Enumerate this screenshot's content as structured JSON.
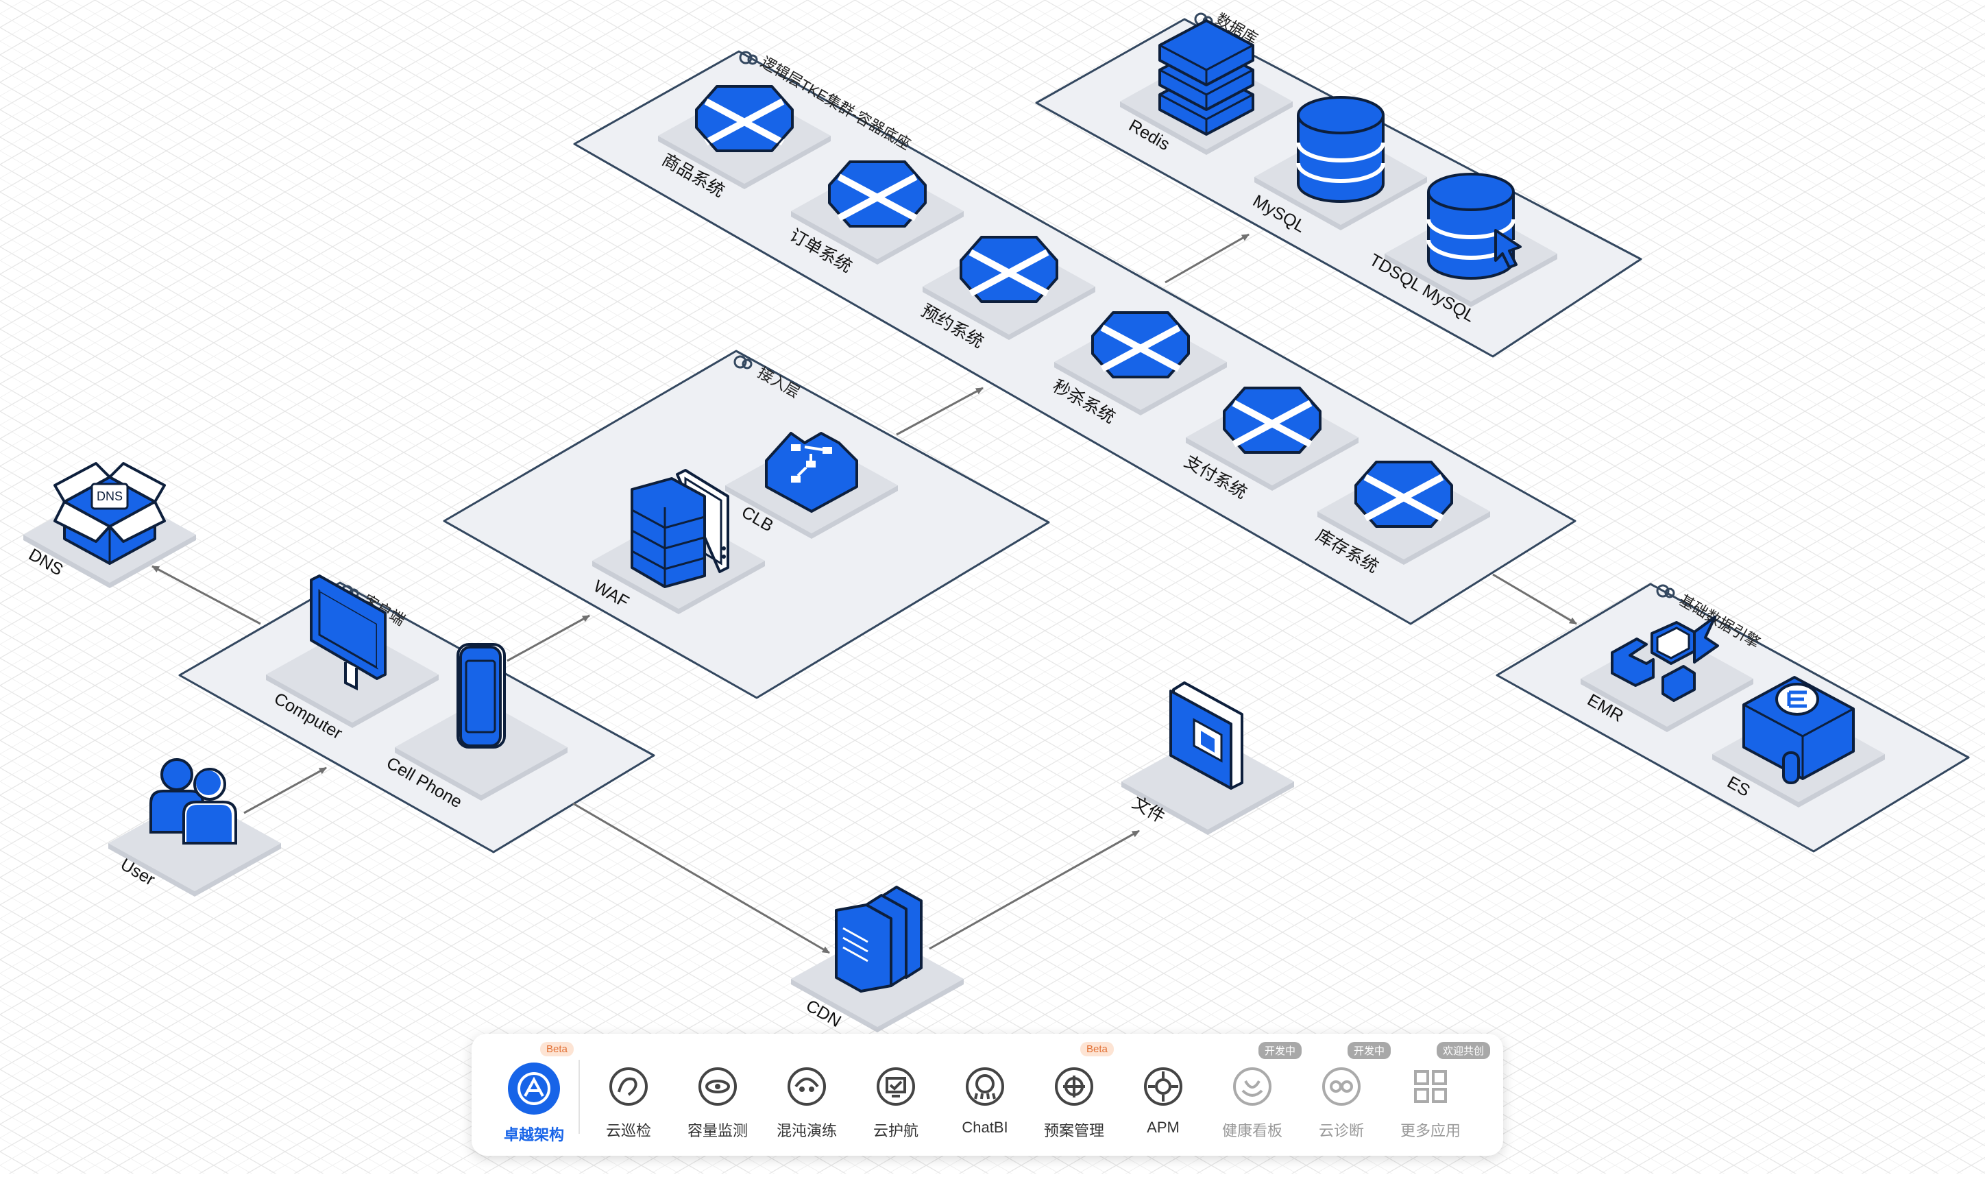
{
  "groups": {
    "logic": "逻辑层TKE集群-容器底座",
    "data": "数据库",
    "access": "接入层",
    "client": "客户端",
    "bigdata": "基础数据引擎"
  },
  "nodes": {
    "goods": "商品系统",
    "order": "订单系统",
    "booking": "预约系统",
    "seckill": "秒杀系统",
    "pay": "支付系统",
    "stock": "库存系统",
    "redis": "Redis",
    "mysql": "MySQL",
    "tdsql": "TDSQL MySQL",
    "clb": "CLB",
    "waf": "WAF",
    "dns": "DNS",
    "dns_box": "DNS",
    "computer": "Computer",
    "phone": "Cell Phone",
    "user": "User",
    "cdn": "CDN",
    "file": "文件",
    "emr": "EMR",
    "es": "ES"
  },
  "toolbar": [
    {
      "label": "卓越架构",
      "badge": "Beta",
      "icon": "architecture-icon",
      "active": true
    },
    {
      "label": "云巡检",
      "icon": "patrol-icon"
    },
    {
      "label": "容量监测",
      "icon": "capacity-icon"
    },
    {
      "label": "混沌演练",
      "icon": "chaos-icon"
    },
    {
      "label": "云护航",
      "icon": "escort-icon"
    },
    {
      "label": "ChatBI",
      "icon": "chatbi-icon"
    },
    {
      "label": "预案管理",
      "badge": "Beta",
      "icon": "plan-icon"
    },
    {
      "label": "APM",
      "icon": "apm-icon"
    },
    {
      "label": "健康看板",
      "badge": "开发中",
      "icon": "health-icon",
      "dim": true
    },
    {
      "label": "云诊断",
      "badge": "开发中",
      "icon": "diagnose-icon",
      "dim": true
    },
    {
      "label": "更多应用",
      "badge": "欢迎共创",
      "icon": "more-apps-icon",
      "dim": true
    }
  ],
  "colors": {
    "accent": "#1764e8",
    "platform": "#dde0e6",
    "group_fill": "#eef0f4",
    "group_stroke": "#33475f",
    "arrow": "#707070"
  }
}
